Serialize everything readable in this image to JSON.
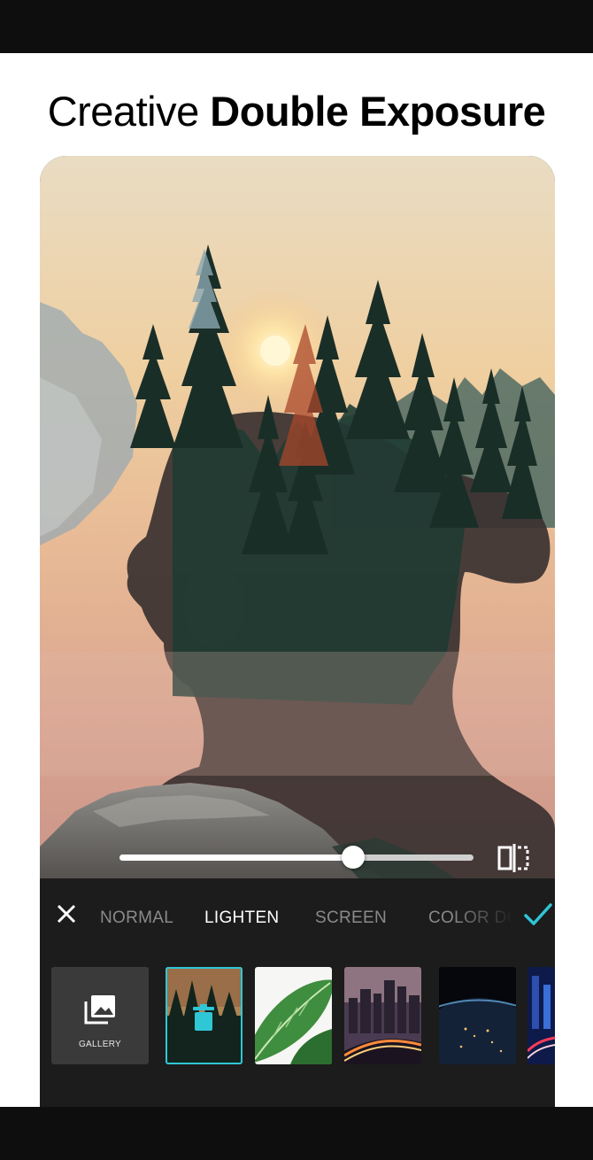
{
  "headline": {
    "light": "Creative",
    "bold": "Double Exposure"
  },
  "editor": {
    "blend_strength": 0.66,
    "blend_modes": [
      {
        "label": "NORMAL",
        "active": false
      },
      {
        "label": "LIGHTEN",
        "active": true
      },
      {
        "label": "SCREEN",
        "active": false
      },
      {
        "label": "COLOR DO",
        "active": false
      }
    ],
    "gallery_label": "GALLERY",
    "accent_color": "#2fc6d6",
    "icons": {
      "close": "close-icon",
      "confirm": "checkmark-icon",
      "compare": "compare-split-icon",
      "gallery": "gallery-icon",
      "delete": "trash-icon"
    }
  }
}
